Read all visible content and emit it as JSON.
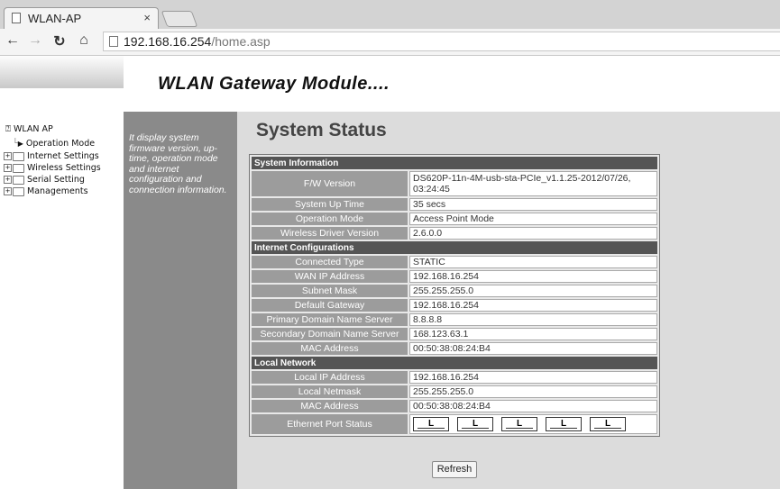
{
  "browser": {
    "tab_title": "WLAN-AP",
    "tab_close": "×",
    "url_host": "192.168.16.254",
    "url_path": "/home.asp",
    "nav_icons": [
      "back-icon",
      "forward-icon",
      "reload-icon",
      "home-icon"
    ]
  },
  "header": {
    "banner": "WLAN Gateway Module...."
  },
  "sidebar": {
    "root": "WLAN AP",
    "items": [
      {
        "label": "Operation Mode",
        "type": "page"
      },
      {
        "label": "Internet Settings",
        "type": "folder"
      },
      {
        "label": "Wireless Settings",
        "type": "folder"
      },
      {
        "label": "Serial Setting",
        "type": "folder"
      },
      {
        "label": "Managements",
        "type": "folder"
      }
    ]
  },
  "description": "It display system firmware version, up-time, operation mode and internet configuration and connection information.",
  "main": {
    "title": "System Status",
    "sections": {
      "system": {
        "header": "System Information",
        "rows": [
          {
            "label": "F/W Version",
            "value": "DS620P-11n-4M-usb-sta-PCIe_v1.1.25-2012/07/26, 03:24:45"
          },
          {
            "label": "System Up Time",
            "value": "35 secs"
          },
          {
            "label": "Operation Mode",
            "value": "Access Point Mode"
          },
          {
            "label": "Wireless Driver Version",
            "value": "2.6.0.0"
          }
        ]
      },
      "internet": {
        "header": "Internet Configurations",
        "rows": [
          {
            "label": "Connected Type",
            "value": "STATIC"
          },
          {
            "label": "WAN IP Address",
            "value": "192.168.16.254"
          },
          {
            "label": "Subnet Mask",
            "value": "255.255.255.0"
          },
          {
            "label": "Default Gateway",
            "value": "192.168.16.254"
          },
          {
            "label": "Primary Domain Name Server",
            "value": "8.8.8.8"
          },
          {
            "label": "Secondary Domain Name Server",
            "value": "168.123.63.1"
          },
          {
            "label": "MAC Address",
            "value": "00:50:38:08:24:B4"
          }
        ]
      },
      "local": {
        "header": "Local Network",
        "rows": [
          {
            "label": "Local IP Address",
            "value": "192.168.16.254"
          },
          {
            "label": "Local Netmask",
            "value": "255.255.255.0"
          },
          {
            "label": "MAC Address",
            "value": "00:50:38:08:24:B4"
          }
        ],
        "ports_label": "Ethernet Port Status",
        "ports": [
          "L",
          "L",
          "L",
          "L",
          "L"
        ]
      }
    },
    "refresh_label": "Refresh"
  }
}
